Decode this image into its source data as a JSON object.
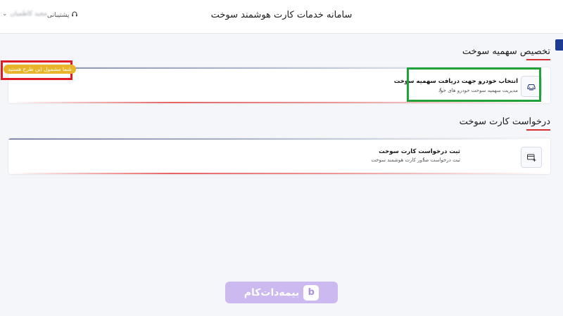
{
  "header": {
    "title": "سامانه خدمات کارت هوشمند سوخت",
    "support_label": "پشتیبانی",
    "user_name": "مجید کاظمیان",
    "support_icon": "headset-icon",
    "user_menu_icon": "chevron-down-icon"
  },
  "sections": [
    {
      "title": "تخصیص سهمیه سوخت",
      "item": {
        "title": "انتخاب خودرو جهت دریافت سهمیه سوخت",
        "subtitle": "مدیریت سهمیه سوخت خودرو های خود",
        "icon": "car-fuel-icon"
      },
      "badge": "شما مشمول این طرح هستید"
    },
    {
      "title": "درخواست کارت سوخت",
      "item": {
        "title": "ثبت درخواست کارت سوخت",
        "subtitle": "ثبت درخواست صدور کارت هوشمند سوخت",
        "icon": "card-add-icon"
      }
    }
  ],
  "watermark": {
    "text": "بیمه‌دات‌کام",
    "logo_letter": "b"
  },
  "colors": {
    "accent_blue": "#1f3a93",
    "underline_red": "#d62f2f",
    "highlight_green": "#1fa23a",
    "highlight_red": "#e01b24",
    "badge_gold": "#e8b429",
    "watermark_purple": "#c9b6ef"
  }
}
